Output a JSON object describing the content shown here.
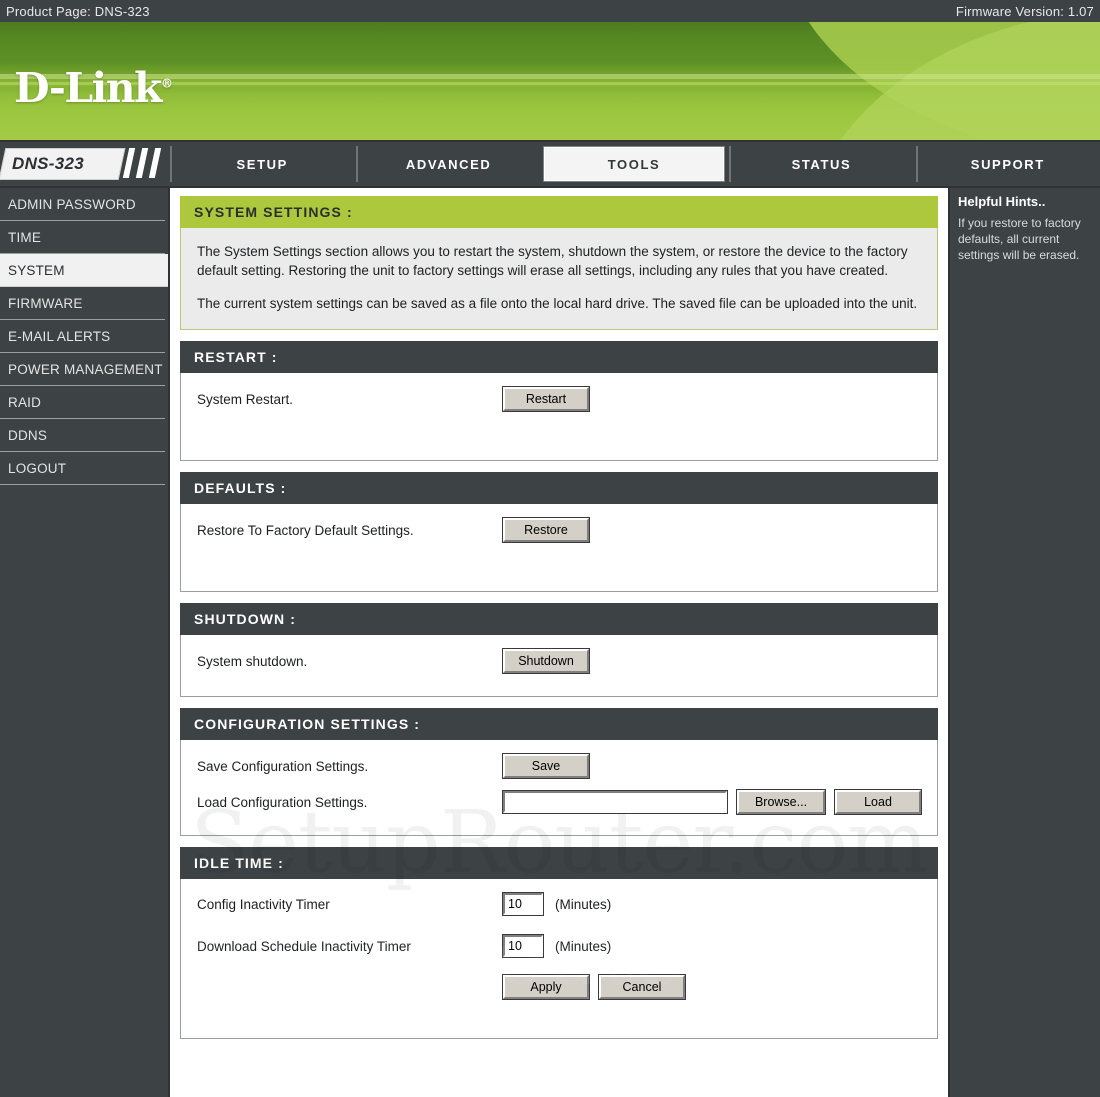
{
  "topbar": {
    "product_page": "Product Page: DNS-323",
    "firmware": "Firmware Version: 1.07"
  },
  "brand": {
    "logo_text": "D-Link",
    "registered_mark": "®"
  },
  "nav": {
    "model_badge": "DNS-323",
    "tabs": [
      {
        "label": "SETUP",
        "active": false
      },
      {
        "label": "ADVANCED",
        "active": false
      },
      {
        "label": "TOOLS",
        "active": true
      },
      {
        "label": "STATUS",
        "active": false
      },
      {
        "label": "SUPPORT",
        "active": false
      }
    ]
  },
  "sidebar": {
    "items": [
      {
        "label": "ADMIN PASSWORD",
        "active": false
      },
      {
        "label": "TIME",
        "active": false
      },
      {
        "label": "SYSTEM",
        "active": true
      },
      {
        "label": "FIRMWARE",
        "active": false
      },
      {
        "label": "E-MAIL ALERTS",
        "active": false
      },
      {
        "label": "POWER MANAGEMENT",
        "active": false
      },
      {
        "label": "RAID",
        "active": false
      },
      {
        "label": "DDNS",
        "active": false
      },
      {
        "label": "LOGOUT",
        "active": false
      }
    ]
  },
  "system_settings": {
    "heading": "SYSTEM SETTINGS :",
    "paragraph_1": "The System Settings section allows you to restart the system, shutdown the system, or restore the device to the factory default setting. Restoring the unit to factory settings will erase all settings, including any rules that you have created.",
    "paragraph_2": "The current system settings can be saved as a file onto the local hard drive. The saved file can be uploaded into the unit."
  },
  "restart": {
    "heading": "RESTART :",
    "label": "System Restart.",
    "button": "Restart"
  },
  "defaults": {
    "heading": "DEFAULTS :",
    "label": "Restore To Factory Default Settings.",
    "button": "Restore"
  },
  "shutdown": {
    "heading": "SHUTDOWN :",
    "label": "System shutdown.",
    "button": "Shutdown"
  },
  "configuration": {
    "heading": "CONFIGURATION SETTINGS :",
    "save_label": "Save Configuration Settings.",
    "save_button": "Save",
    "load_label": "Load Configuration Settings.",
    "file_value": "",
    "browse_button": "Browse...",
    "load_button": "Load"
  },
  "idle_time": {
    "heading": "IDLE TIME :",
    "config_timer_label": "Config Inactivity Timer",
    "config_timer_value": "10",
    "config_timer_units": "(Minutes)",
    "download_timer_label": "Download Schedule Inactivity Timer",
    "download_timer_value": "10",
    "download_timer_units": "(Minutes)",
    "apply_button": "Apply",
    "cancel_button": "Cancel"
  },
  "hints": {
    "title": "Helpful Hints..",
    "text": "If you restore to factory defaults, all current settings will be erased."
  },
  "watermark": {
    "text": "SetupRouter.com"
  },
  "colors": {
    "dark_chrome": "#3d4244",
    "accent_green": "#adc83c",
    "banner_green_top": "#4d7c20",
    "banner_green_bottom": "#a3cb46",
    "panel_header": "#3d4244"
  }
}
